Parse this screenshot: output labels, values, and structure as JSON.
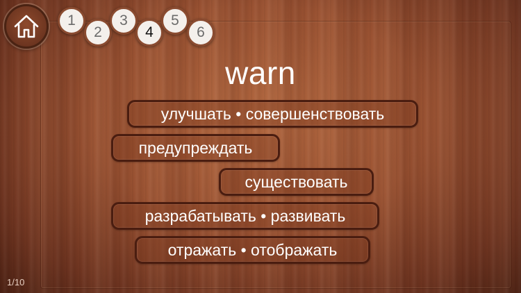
{
  "word": "warn",
  "counter": "1/10",
  "levels": [
    {
      "label": "1"
    },
    {
      "label": "2"
    },
    {
      "label": "3"
    },
    {
      "label": "4"
    },
    {
      "label": "5"
    },
    {
      "label": "6"
    }
  ],
  "active_level": "4",
  "options": [
    {
      "label": "улучшать • совершенствовать"
    },
    {
      "label": "предупреждать"
    },
    {
      "label": "существовать"
    },
    {
      "label": "разрабатывать • развивать"
    },
    {
      "label": "отражать • отображать"
    }
  ],
  "icons": {
    "home": "home-icon"
  },
  "colors": {
    "option_border": "#4a1d10",
    "text": "#ffffff",
    "level_badge": "#f4f0ec"
  }
}
